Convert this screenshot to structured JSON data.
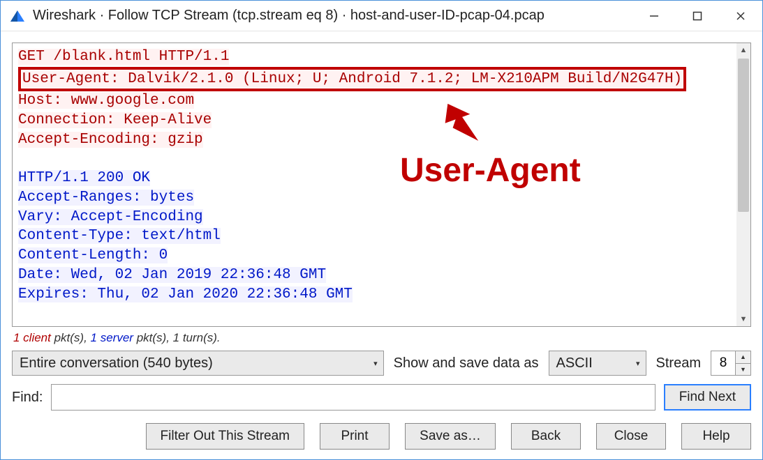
{
  "window": {
    "title": "Wireshark · Follow TCP Stream (tcp.stream eq 8) · host-and-user-ID-pcap-04.pcap"
  },
  "stream": {
    "request_lines": [
      "GET /blank.html HTTP/1.1",
      "User-Agent: Dalvik/2.1.0 (Linux; U; Android 7.1.2; LM-X210APM Build/N2G47H)",
      "Host: www.google.com",
      "Connection: Keep-Alive",
      "Accept-Encoding: gzip"
    ],
    "response_lines": [
      "HTTP/1.1 200 OK",
      "Accept-Ranges: bytes",
      "Vary: Accept-Encoding",
      "Content-Type: text/html",
      "Content-Length: 0",
      "Date: Wed, 02 Jan 2019 22:36:48 GMT",
      "Expires: Thu, 02 Jan 2020 22:36:48 GMT"
    ]
  },
  "annotation": {
    "label": "User-Agent"
  },
  "status": {
    "client_pkts": "1 client",
    "pkts_mid": " pkt(s), ",
    "server_pkts": "1 server",
    "pkts_end": " pkt(s), 1 turn(s)."
  },
  "controls": {
    "conversation_selected": "Entire conversation (540 bytes)",
    "show_save_as_label": "Show and save data as",
    "encoding_selected": "ASCII",
    "stream_label": "Stream",
    "stream_value": "8"
  },
  "find": {
    "label": "Find:",
    "value": "",
    "find_next": "Find Next"
  },
  "buttons": {
    "filter_out": "Filter Out This Stream",
    "print": "Print",
    "save_as": "Save as…",
    "back": "Back",
    "close": "Close",
    "help": "Help"
  }
}
